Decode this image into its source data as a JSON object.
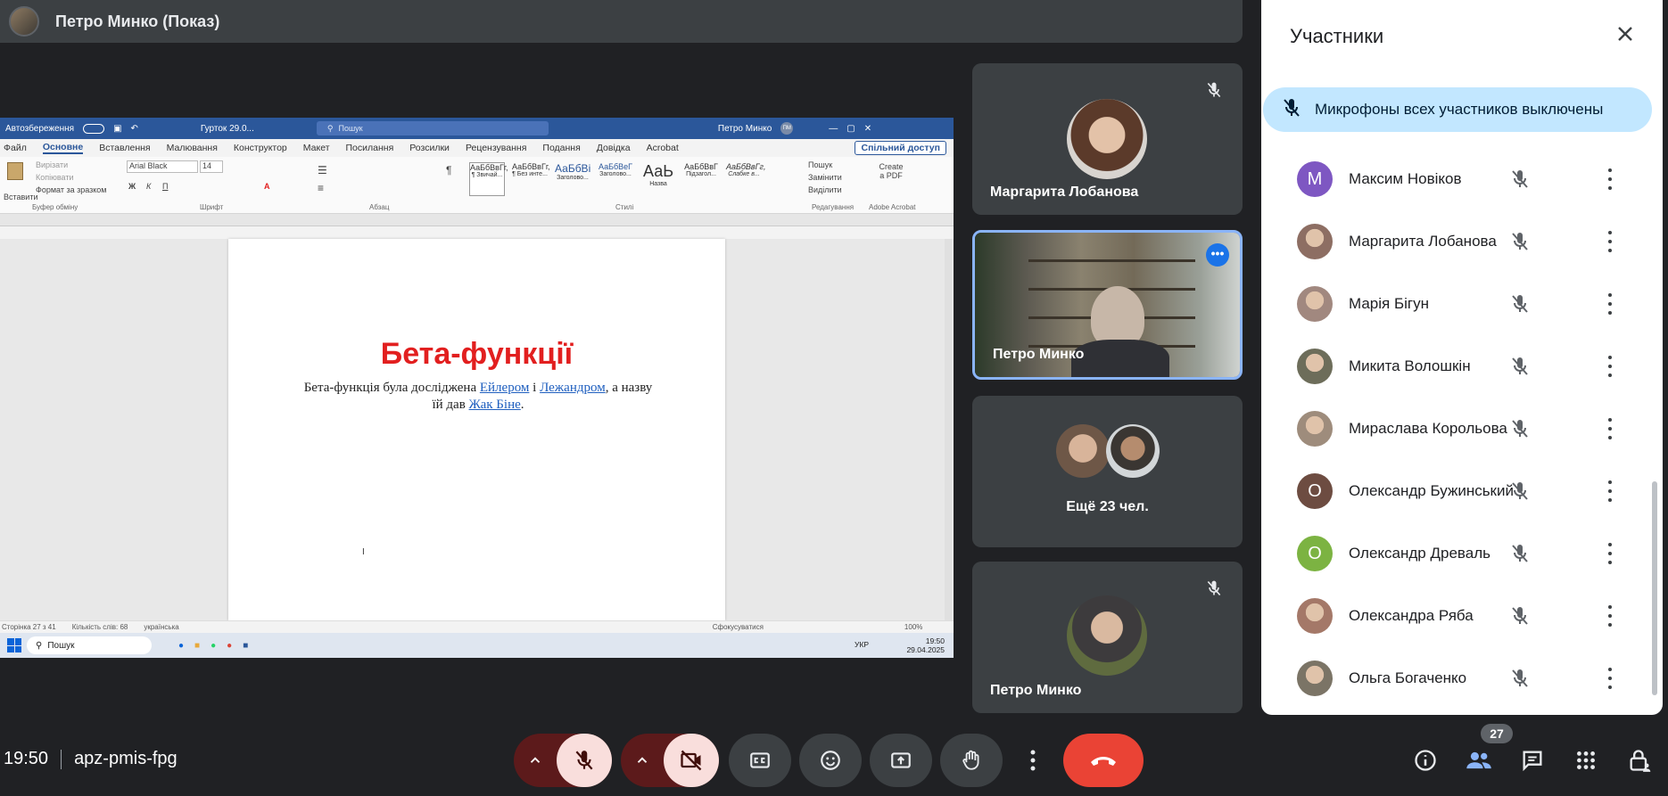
{
  "presenter": {
    "title": "Петро Минко (Показ)"
  },
  "word": {
    "autosave": "Автозбереження",
    "doc_name": "Гурток 29.0...",
    "search": "Пошук",
    "user": "Петро Минко",
    "user_initials": "ПМ",
    "tabs": [
      "Файл",
      "Основне",
      "Вставлення",
      "Малювання",
      "Конструктор",
      "Макет",
      "Посилання",
      "Розсилки",
      "Рецензування",
      "Подання",
      "Довідка",
      "Acrobat"
    ],
    "share": "Спільний доступ",
    "clipboard": {
      "paste": "Вставити",
      "cut": "Вирізати",
      "copy": "Копіювати",
      "format": "Формат за зразком",
      "label": "Буфер обміну"
    },
    "font": {
      "name": "Arial Black",
      "size": "14",
      "label": "Шрифт"
    },
    "paragraph_label": "Абзац",
    "styles": [
      "АаБбВвГг,",
      "АаБбВвГг,",
      "АаБбВі",
      "АаБбВеГ",
      "АаЬ",
      "АаБбВвГ",
      "АаБбВвГг,"
    ],
    "style_names": [
      "¶ Звичай...",
      "¶ Без инте...",
      "Заголово...",
      "Заголово...",
      "Назва",
      "Підзагол...",
      "Слабке в..."
    ],
    "styles_label": "Стилі",
    "editing": {
      "find": "Пошук",
      "replace": "Замінити",
      "select": "Виділити",
      "label": "Редагування"
    },
    "acrobat": {
      "create": "Create a PDF",
      "label": "Adobe Acrobat"
    },
    "doc": {
      "heading": "Бета-функції",
      "para_1": "Бета-функція була досліджена ",
      "link_euler": "Ейлером",
      "para_2": " і ",
      "link_legendre": "Лежандром",
      "para_3": ", а назву їй дав ",
      "link_binet": "Жак Біне",
      "para_4": "."
    },
    "status": {
      "page": "Сторінка 27 з 41",
      "words": "Кількість слів: 68",
      "lang": "українська",
      "focus": "Сфокусуватися",
      "zoom": "100%"
    },
    "taskbar": {
      "search": "Пошук",
      "lang": "УКР",
      "time": "19:50",
      "date": "29.04.2025"
    }
  },
  "tiles": [
    {
      "name": "Маргарита Лобанова"
    },
    {
      "name": "Петро Минко"
    },
    {
      "name": "Ещё 23 чел."
    },
    {
      "name": "Петро Минко"
    }
  ],
  "panel": {
    "title": "Участники",
    "banner": "Микрофоны всех участников выключены",
    "participants": [
      {
        "name": "Максим Новіков",
        "initial": "М",
        "color": "#7e57c2"
      },
      {
        "name": "Маргарита Лобанова",
        "initial": "",
        "color": "#8d6e63"
      },
      {
        "name": "Марія Бігун",
        "initial": "",
        "color": "#a1887f"
      },
      {
        "name": "Микита Волошкін",
        "initial": "",
        "color": "#6d6d5a"
      },
      {
        "name": "Мираслава Корольова",
        "initial": "",
        "color": "#9e8c7c"
      },
      {
        "name": "Олександр Бужинський",
        "initial": "О",
        "color": "#6d4c41"
      },
      {
        "name": "Олександр Древаль",
        "initial": "О",
        "color": "#7cb342"
      },
      {
        "name": "Олександра Ряба",
        "initial": "",
        "color": "#a47868"
      },
      {
        "name": "Ольга Богаченко",
        "initial": "",
        "color": "#7b7466"
      }
    ]
  },
  "bottom": {
    "time": "19:50",
    "meeting_code": "apz-pmis-fpg",
    "participants_count": "27"
  }
}
